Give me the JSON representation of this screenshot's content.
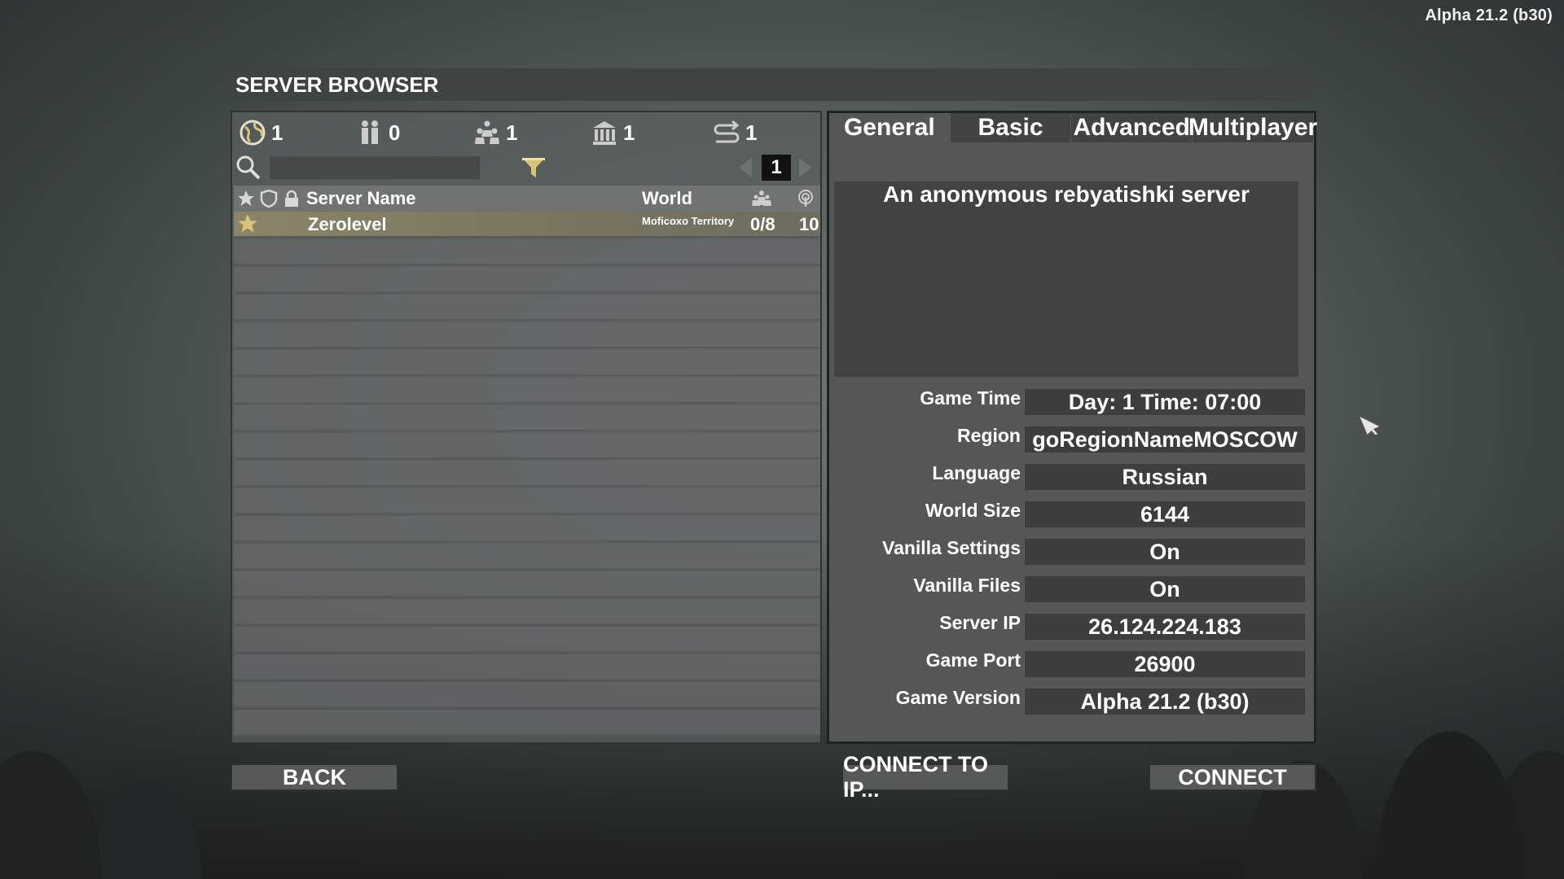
{
  "version": "Alpha 21.2 (b30)",
  "title": "SERVER BROWSER",
  "stats": [
    {
      "icon": "globe-icon",
      "count": "1"
    },
    {
      "icon": "friends-icon",
      "count": "0"
    },
    {
      "icon": "players-icon",
      "count": "1"
    },
    {
      "icon": "dedicated-server-icon",
      "count": "1"
    },
    {
      "icon": "lan-icon",
      "count": "1"
    }
  ],
  "search": {
    "value": "",
    "placeholder": ""
  },
  "pagination": {
    "current": "1"
  },
  "list_headers": {
    "name": "Server Name",
    "world": "World"
  },
  "servers": [
    {
      "favorite": true,
      "name": "Zerolevel",
      "world": "Moficoxo Territory",
      "players": "0/8",
      "ping": "10"
    }
  ],
  "tabs": [
    "General",
    "Basic",
    "Advanced",
    "Multiplayer"
  ],
  "description": "An anonymous rebyatishki server",
  "details": [
    {
      "label": "Game Time",
      "value": "Day: 1 Time: 07:00"
    },
    {
      "label": "Region",
      "value": "goRegionNameMOSCOW"
    },
    {
      "label": "Language",
      "value": "Russian"
    },
    {
      "label": "World Size",
      "value": "6144"
    },
    {
      "label": "Vanilla Settings",
      "value": "On"
    },
    {
      "label": "Vanilla Files",
      "value": "On"
    },
    {
      "label": "Server IP",
      "value": "26.124.224.183"
    },
    {
      "label": "Game Port",
      "value": "26900"
    },
    {
      "label": "Game Version",
      "value": "Alpha 21.2 (b30)"
    }
  ],
  "buttons": {
    "back": "BACK",
    "connect_ip": "CONNECT TO IP...",
    "connect": "CONNECT"
  },
  "colors": {
    "favorite_star": "#d9c27a",
    "filter": "#d9c27a",
    "selected_row": "#8b8467"
  }
}
